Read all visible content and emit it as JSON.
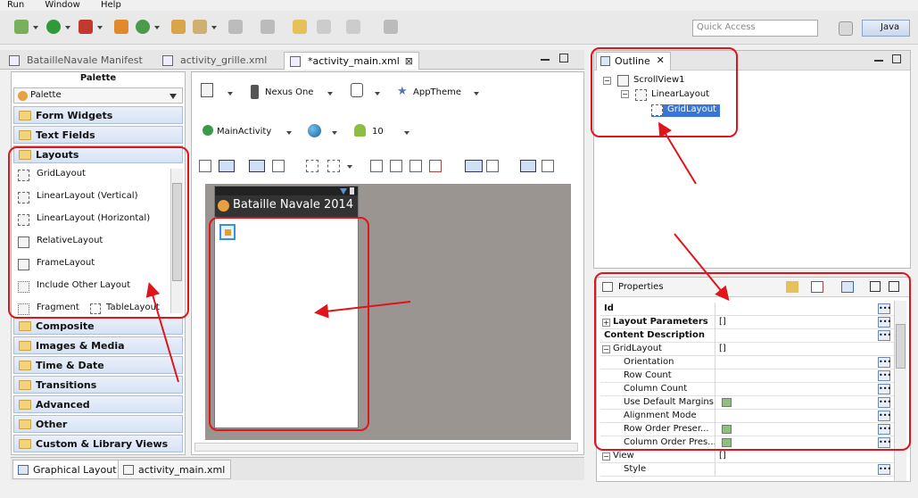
{
  "menu": [
    "Run",
    "Window",
    "Help"
  ],
  "toolbar": {
    "quick_access_placeholder": "Quick Access",
    "perspective": "Java"
  },
  "editor_tabs": [
    {
      "label": "BatailleNavale Manifest"
    },
    {
      "label": "activity_grille.xml"
    },
    {
      "label": "*activity_main.xml",
      "close": "⊠"
    }
  ],
  "palette": {
    "title": "Palette",
    "selector": "Palette",
    "categories_top": [
      "Form Widgets",
      "Text Fields"
    ],
    "open_category": "Layouts",
    "layout_items": [
      "GridLayout",
      "LinearLayout (Vertical)",
      "LinearLayout (Horizontal)",
      "RelativeLayout",
      "FrameLayout",
      "Include Other Layout",
      "Fragment",
      "TableLayout"
    ],
    "categories_bottom": [
      "Composite",
      "Images & Media",
      "Time & Date",
      "Transitions",
      "Advanced",
      "Other",
      "Custom & Library Views"
    ]
  },
  "canvas_toolbar": {
    "device": "Nexus One",
    "theme": "AppTheme",
    "activity": "MainActivity",
    "api": "10"
  },
  "device_screen": {
    "app_title": "Bataille Navale 2014"
  },
  "bottom_tabs": [
    "Graphical Layout",
    "activity_main.xml"
  ],
  "outline": {
    "title": "Outline",
    "tree": [
      {
        "label": "ScrollView1",
        "level": 0
      },
      {
        "label": "LinearLayout",
        "level": 1
      },
      {
        "label": "GridLayout",
        "level": 2,
        "selected": true
      }
    ]
  },
  "properties": {
    "title": "Properties",
    "rows": [
      {
        "name": "Id",
        "value": "",
        "style": "bold"
      },
      {
        "name": "Layout Parameters",
        "value": "[]",
        "style": "bold",
        "expander": "+"
      },
      {
        "name": "Content Description",
        "value": "",
        "style": "bold"
      },
      {
        "name": "GridLayout",
        "value": "[]",
        "style": "normal",
        "expander": "-"
      },
      {
        "name": "Orientation",
        "value": "",
        "style": "indent"
      },
      {
        "name": "Row Count",
        "value": "",
        "style": "indent"
      },
      {
        "name": "Column Count",
        "value": "",
        "style": "indent"
      },
      {
        "name": "Use Default Margins",
        "value": "",
        "style": "indent",
        "checkbox": true
      },
      {
        "name": "Alignment Mode",
        "value": "",
        "style": "indent"
      },
      {
        "name": "Row Order Preser...",
        "value": "",
        "style": "indent",
        "checkbox": true
      },
      {
        "name": "Column Order Pres...",
        "value": "",
        "style": "indent",
        "checkbox": true
      },
      {
        "name": "View",
        "value": "[]",
        "style": "normal",
        "expander": "-"
      },
      {
        "name": "Style",
        "value": "",
        "style": "indent"
      }
    ]
  },
  "colors": {
    "annotation": "#e0141b",
    "selection": "#3875d7"
  }
}
